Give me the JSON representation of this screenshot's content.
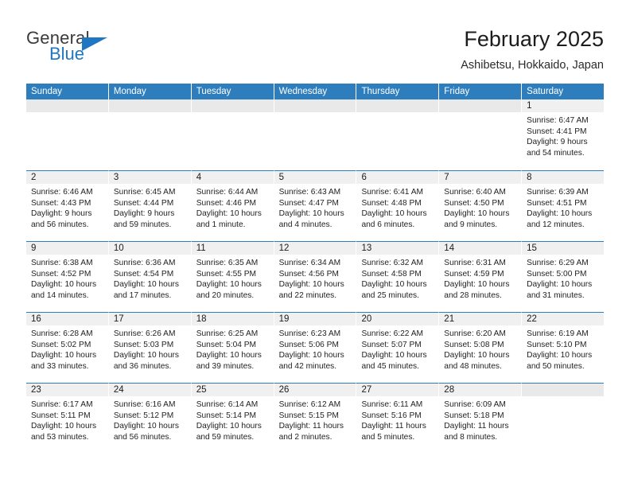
{
  "brand": {
    "name_top": "General",
    "name_bottom": "Blue",
    "accent_color": "#1f76c2"
  },
  "header": {
    "title": "February 2025",
    "subtitle": "Ashibetsu, Hokkaido, Japan"
  },
  "theme": {
    "header_blue": "#2e7ebd",
    "daynum_gray": "#f0f0f0"
  },
  "weekdays": [
    "Sunday",
    "Monday",
    "Tuesday",
    "Wednesday",
    "Thursday",
    "Friday",
    "Saturday"
  ],
  "weeks": [
    [
      {
        "day": "",
        "empty": true
      },
      {
        "day": "",
        "empty": true
      },
      {
        "day": "",
        "empty": true
      },
      {
        "day": "",
        "empty": true
      },
      {
        "day": "",
        "empty": true
      },
      {
        "day": "",
        "empty": true
      },
      {
        "day": "1",
        "sunrise": "Sunrise: 6:47 AM",
        "sunset": "Sunset: 4:41 PM",
        "daylight": "Daylight: 9 hours and 54 minutes."
      }
    ],
    [
      {
        "day": "2",
        "sunrise": "Sunrise: 6:46 AM",
        "sunset": "Sunset: 4:43 PM",
        "daylight": "Daylight: 9 hours and 56 minutes."
      },
      {
        "day": "3",
        "sunrise": "Sunrise: 6:45 AM",
        "sunset": "Sunset: 4:44 PM",
        "daylight": "Daylight: 9 hours and 59 minutes."
      },
      {
        "day": "4",
        "sunrise": "Sunrise: 6:44 AM",
        "sunset": "Sunset: 4:46 PM",
        "daylight": "Daylight: 10 hours and 1 minute."
      },
      {
        "day": "5",
        "sunrise": "Sunrise: 6:43 AM",
        "sunset": "Sunset: 4:47 PM",
        "daylight": "Daylight: 10 hours and 4 minutes."
      },
      {
        "day": "6",
        "sunrise": "Sunrise: 6:41 AM",
        "sunset": "Sunset: 4:48 PM",
        "daylight": "Daylight: 10 hours and 6 minutes."
      },
      {
        "day": "7",
        "sunrise": "Sunrise: 6:40 AM",
        "sunset": "Sunset: 4:50 PM",
        "daylight": "Daylight: 10 hours and 9 minutes."
      },
      {
        "day": "8",
        "sunrise": "Sunrise: 6:39 AM",
        "sunset": "Sunset: 4:51 PM",
        "daylight": "Daylight: 10 hours and 12 minutes."
      }
    ],
    [
      {
        "day": "9",
        "sunrise": "Sunrise: 6:38 AM",
        "sunset": "Sunset: 4:52 PM",
        "daylight": "Daylight: 10 hours and 14 minutes."
      },
      {
        "day": "10",
        "sunrise": "Sunrise: 6:36 AM",
        "sunset": "Sunset: 4:54 PM",
        "daylight": "Daylight: 10 hours and 17 minutes."
      },
      {
        "day": "11",
        "sunrise": "Sunrise: 6:35 AM",
        "sunset": "Sunset: 4:55 PM",
        "daylight": "Daylight: 10 hours and 20 minutes."
      },
      {
        "day": "12",
        "sunrise": "Sunrise: 6:34 AM",
        "sunset": "Sunset: 4:56 PM",
        "daylight": "Daylight: 10 hours and 22 minutes."
      },
      {
        "day": "13",
        "sunrise": "Sunrise: 6:32 AM",
        "sunset": "Sunset: 4:58 PM",
        "daylight": "Daylight: 10 hours and 25 minutes."
      },
      {
        "day": "14",
        "sunrise": "Sunrise: 6:31 AM",
        "sunset": "Sunset: 4:59 PM",
        "daylight": "Daylight: 10 hours and 28 minutes."
      },
      {
        "day": "15",
        "sunrise": "Sunrise: 6:29 AM",
        "sunset": "Sunset: 5:00 PM",
        "daylight": "Daylight: 10 hours and 31 minutes."
      }
    ],
    [
      {
        "day": "16",
        "sunrise": "Sunrise: 6:28 AM",
        "sunset": "Sunset: 5:02 PM",
        "daylight": "Daylight: 10 hours and 33 minutes."
      },
      {
        "day": "17",
        "sunrise": "Sunrise: 6:26 AM",
        "sunset": "Sunset: 5:03 PM",
        "daylight": "Daylight: 10 hours and 36 minutes."
      },
      {
        "day": "18",
        "sunrise": "Sunrise: 6:25 AM",
        "sunset": "Sunset: 5:04 PM",
        "daylight": "Daylight: 10 hours and 39 minutes."
      },
      {
        "day": "19",
        "sunrise": "Sunrise: 6:23 AM",
        "sunset": "Sunset: 5:06 PM",
        "daylight": "Daylight: 10 hours and 42 minutes."
      },
      {
        "day": "20",
        "sunrise": "Sunrise: 6:22 AM",
        "sunset": "Sunset: 5:07 PM",
        "daylight": "Daylight: 10 hours and 45 minutes."
      },
      {
        "day": "21",
        "sunrise": "Sunrise: 6:20 AM",
        "sunset": "Sunset: 5:08 PM",
        "daylight": "Daylight: 10 hours and 48 minutes."
      },
      {
        "day": "22",
        "sunrise": "Sunrise: 6:19 AM",
        "sunset": "Sunset: 5:10 PM",
        "daylight": "Daylight: 10 hours and 50 minutes."
      }
    ],
    [
      {
        "day": "23",
        "sunrise": "Sunrise: 6:17 AM",
        "sunset": "Sunset: 5:11 PM",
        "daylight": "Daylight: 10 hours and 53 minutes."
      },
      {
        "day": "24",
        "sunrise": "Sunrise: 6:16 AM",
        "sunset": "Sunset: 5:12 PM",
        "daylight": "Daylight: 10 hours and 56 minutes."
      },
      {
        "day": "25",
        "sunrise": "Sunrise: 6:14 AM",
        "sunset": "Sunset: 5:14 PM",
        "daylight": "Daylight: 10 hours and 59 minutes."
      },
      {
        "day": "26",
        "sunrise": "Sunrise: 6:12 AM",
        "sunset": "Sunset: 5:15 PM",
        "daylight": "Daylight: 11 hours and 2 minutes."
      },
      {
        "day": "27",
        "sunrise": "Sunrise: 6:11 AM",
        "sunset": "Sunset: 5:16 PM",
        "daylight": "Daylight: 11 hours and 5 minutes."
      },
      {
        "day": "28",
        "sunrise": "Sunrise: 6:09 AM",
        "sunset": "Sunset: 5:18 PM",
        "daylight": "Daylight: 11 hours and 8 minutes."
      },
      {
        "day": "",
        "empty": true
      }
    ]
  ]
}
